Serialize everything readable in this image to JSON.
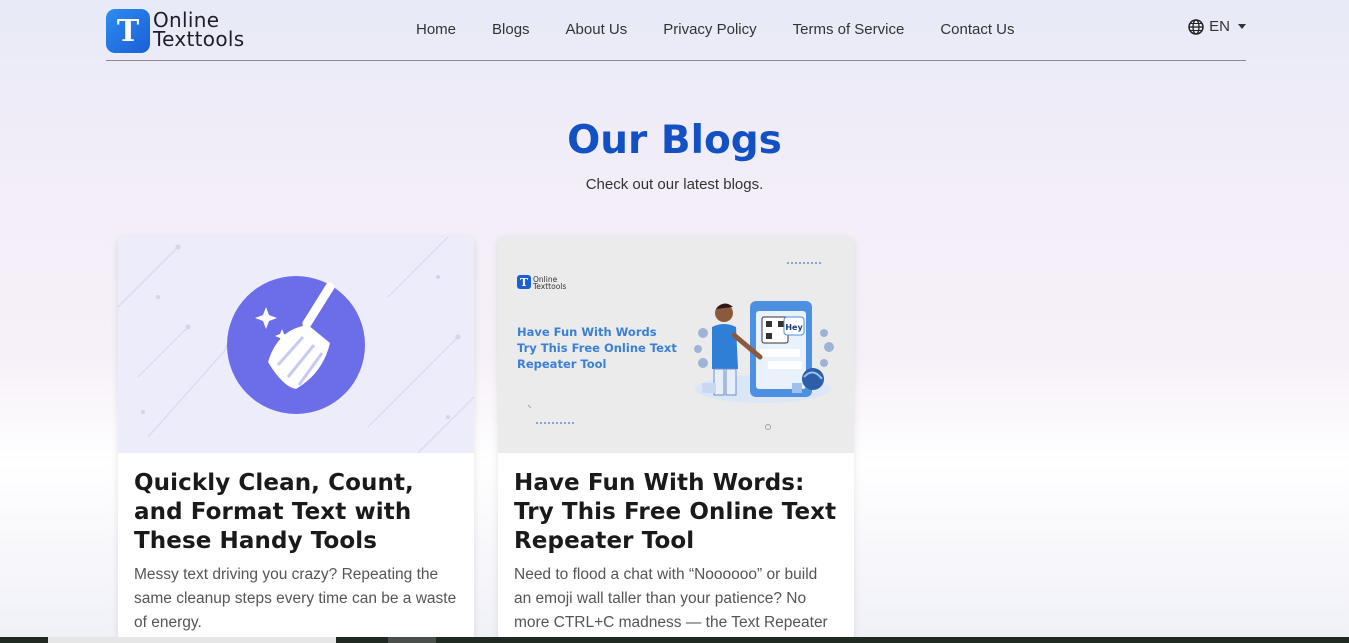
{
  "brand": {
    "logo_letter": "T",
    "line1": "Online",
    "line2": "Texttools"
  },
  "nav": {
    "links": [
      "Home",
      "Blogs",
      "About Us",
      "Privacy Policy",
      "Terms of Service",
      "Contact Us"
    ],
    "language": "EN"
  },
  "hero": {
    "title": "Our Blogs",
    "subtitle": "Check out our latest blogs."
  },
  "cards": [
    {
      "title": "Quickly Clean, Count, and Format Text with These Handy Tools",
      "excerpt": "Messy text driving you crazy? Repeating the same cleanup steps every time can be a waste of energy.",
      "image": {
        "icon": "broom-icon",
        "accent": "#6b6ee8"
      }
    },
    {
      "title": "Have Fun With Words: Try This Free Online Text Repeater Tool",
      "excerpt": "Need to flood a chat with “Noooooo” or build an emoji wall taller than your patience? No more CTRL+C madness — the Text Repeater",
      "image": {
        "brand_line1": "Online",
        "brand_line2": "Texttools",
        "headline": [
          "Have Fun With Words",
          "Try This Free Online Text",
          "Repeater Tool"
        ],
        "bubble": "Hey",
        "accent": "#3b7fd6"
      }
    }
  ],
  "colors": {
    "title_blue": "#1350c4",
    "logo_blue": "#1a5fd6"
  }
}
